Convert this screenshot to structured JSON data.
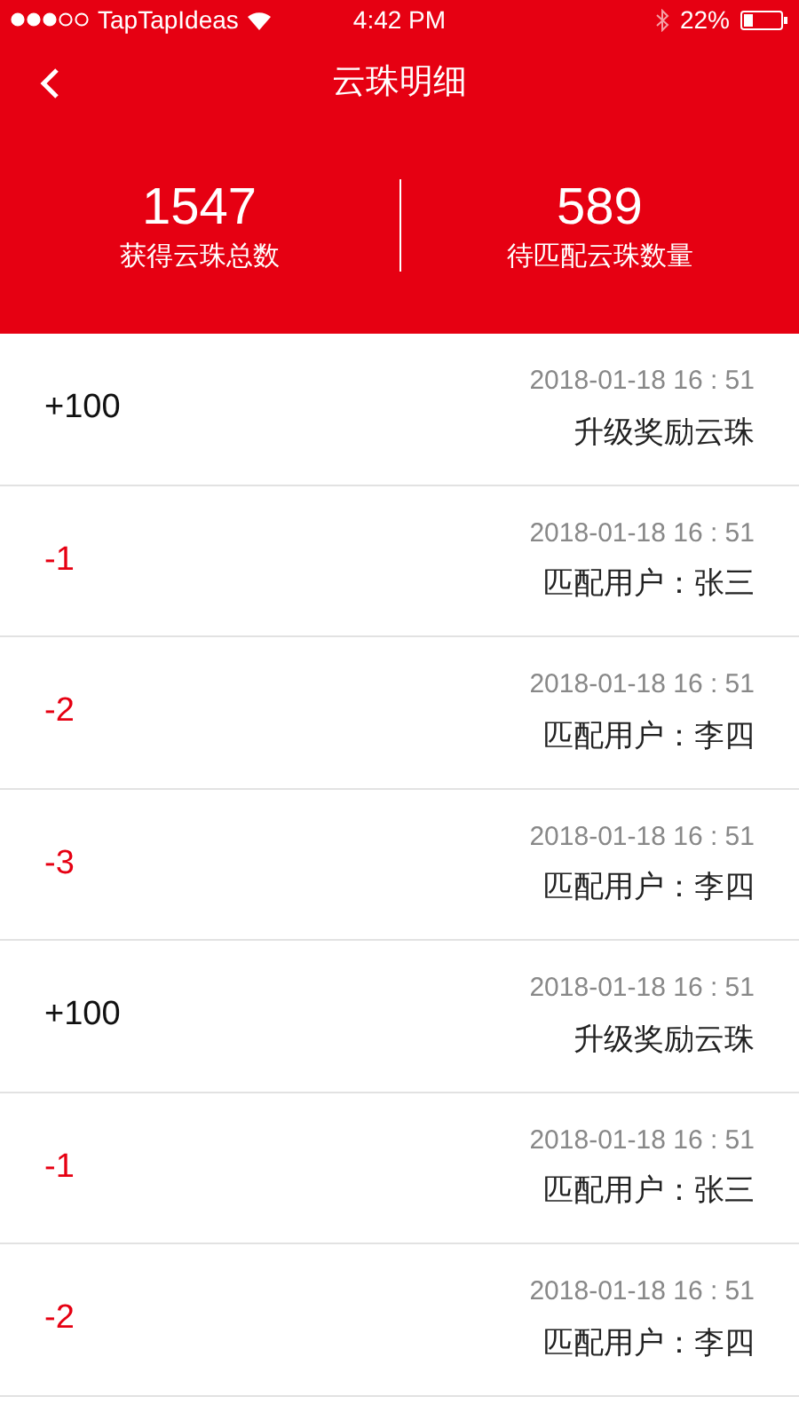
{
  "status_bar": {
    "carrier": "TapTapIdeas",
    "time": "4:42 PM",
    "battery": "22%"
  },
  "nav": {
    "title": "云珠明细"
  },
  "summary": [
    {
      "value": "1547",
      "label": "获得云珠总数"
    },
    {
      "value": "589",
      "label": "待匹配云珠数量"
    }
  ],
  "records": [
    {
      "kind": "credit",
      "amount": "+100",
      "time": "2018-01-18 16 : 51",
      "description": "升级奖励云珠"
    },
    {
      "kind": "debit",
      "amount": "-1",
      "time": "2018-01-18 16 : 51",
      "description": "匹配用户：张三"
    },
    {
      "kind": "debit",
      "amount": "-2",
      "time": "2018-01-18 16 : 51",
      "description": "匹配用户：李四"
    },
    {
      "kind": "debit",
      "amount": "-3",
      "time": "2018-01-18 16 : 51",
      "description": "匹配用户：李四"
    },
    {
      "kind": "credit",
      "amount": "+100",
      "time": "2018-01-18 16 : 51",
      "description": "升级奖励云珠"
    },
    {
      "kind": "debit",
      "amount": "-1",
      "time": "2018-01-18 16 : 51",
      "description": "匹配用户：张三"
    },
    {
      "kind": "debit",
      "amount": "-2",
      "time": "2018-01-18 16 : 51",
      "description": "匹配用户：李四"
    }
  ]
}
